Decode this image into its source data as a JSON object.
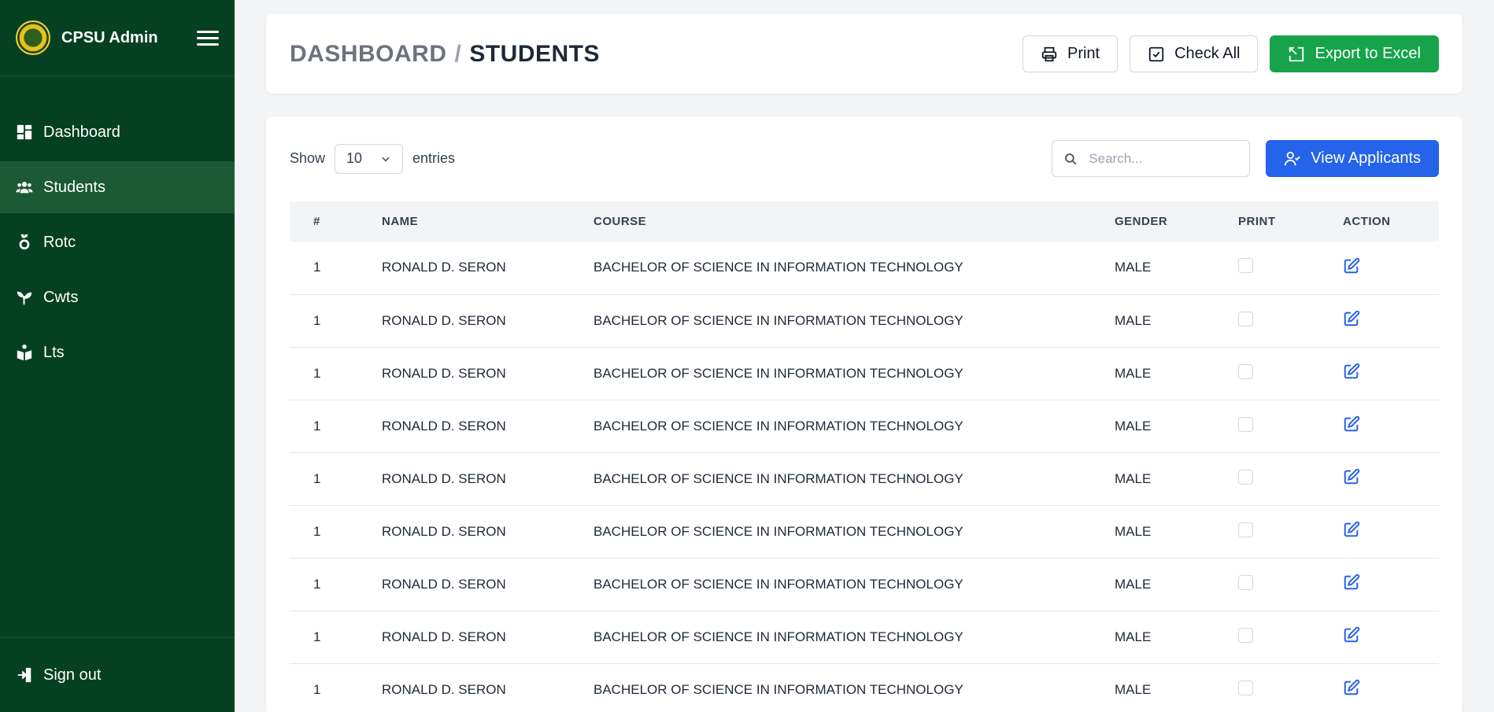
{
  "app": {
    "title": "CPSU Admin"
  },
  "sidebar": {
    "items": [
      {
        "label": "Dashboard",
        "icon": "dashboard-icon",
        "active": false
      },
      {
        "label": "Students",
        "icon": "users-icon",
        "active": true
      },
      {
        "label": "Rotc",
        "icon": "medal-icon",
        "active": false
      },
      {
        "label": "Cwts",
        "icon": "sprout-icon",
        "active": false
      },
      {
        "label": "Lts",
        "icon": "book-reader-icon",
        "active": false
      }
    ],
    "signout_label": "Sign out"
  },
  "header": {
    "crumb_root": "DASHBOARD",
    "crumb_sep": "/",
    "crumb_current": "STUDENTS",
    "print_label": "Print",
    "check_all_label": "Check All",
    "export_label": "Export to Excel"
  },
  "controls": {
    "show_label": "Show",
    "entries_value": "10",
    "entries_label": "entries",
    "search_placeholder": "Search...",
    "view_applicants_label": "View Applicants"
  },
  "table": {
    "columns": [
      "#",
      "NAME",
      "COURSE",
      "GENDER",
      "PRINT",
      "ACTION"
    ],
    "rows": [
      {
        "num": "1",
        "name": "RONALD D. SERON",
        "course": "BACHELOR OF SCIENCE IN INFORMATION TECHNOLOGY",
        "gender": "MALE"
      },
      {
        "num": "1",
        "name": "RONALD D. SERON",
        "course": "BACHELOR OF SCIENCE IN INFORMATION TECHNOLOGY",
        "gender": "MALE"
      },
      {
        "num": "1",
        "name": "RONALD D. SERON",
        "course": "BACHELOR OF SCIENCE IN INFORMATION TECHNOLOGY",
        "gender": "MALE"
      },
      {
        "num": "1",
        "name": "RONALD D. SERON",
        "course": "BACHELOR OF SCIENCE IN INFORMATION TECHNOLOGY",
        "gender": "MALE"
      },
      {
        "num": "1",
        "name": "RONALD D. SERON",
        "course": "BACHELOR OF SCIENCE IN INFORMATION TECHNOLOGY",
        "gender": "MALE"
      },
      {
        "num": "1",
        "name": "RONALD D. SERON",
        "course": "BACHELOR OF SCIENCE IN INFORMATION TECHNOLOGY",
        "gender": "MALE"
      },
      {
        "num": "1",
        "name": "RONALD D. SERON",
        "course": "BACHELOR OF SCIENCE IN INFORMATION TECHNOLOGY",
        "gender": "MALE"
      },
      {
        "num": "1",
        "name": "RONALD D. SERON",
        "course": "BACHELOR OF SCIENCE IN INFORMATION TECHNOLOGY",
        "gender": "MALE"
      },
      {
        "num": "1",
        "name": "RONALD D. SERON",
        "course": "BACHELOR OF SCIENCE IN INFORMATION TECHNOLOGY",
        "gender": "MALE"
      }
    ]
  },
  "colors": {
    "sidebar_bg": "#064022",
    "sidebar_active": "#1b5a32",
    "export_green": "#16a34a",
    "primary_blue": "#2563eb",
    "edit_icon_blue": "#2563eb"
  }
}
